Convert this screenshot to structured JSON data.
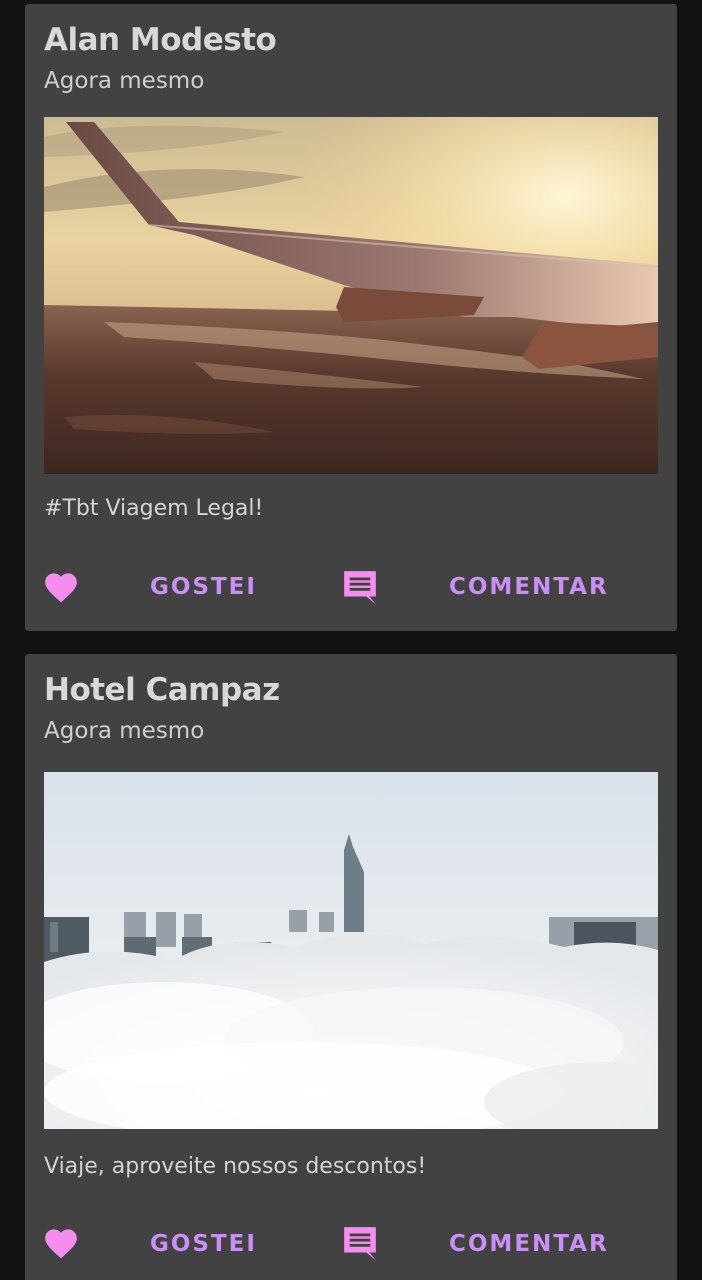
{
  "posts": [
    {
      "author": "Alan Modesto",
      "time": "Agora mesmo",
      "image": "airplane-wing-sunset-photo",
      "caption": "#Tbt Viagem Legal!",
      "like_label": "GOSTEI",
      "comment_label": "COMENTAR"
    },
    {
      "author": "Hotel Campaz",
      "time": "Agora mesmo",
      "image": "city-above-clouds-photo",
      "caption": "Viaje, aproveite nossos descontos!",
      "like_label": "GOSTEI",
      "comment_label": "COMENTAR"
    }
  ],
  "icons": {
    "like": "heart-icon",
    "comment": "comment-icon"
  },
  "colors": {
    "background": "#131313",
    "card": "#424242",
    "accent_text": "#c98ff5",
    "icon_pink": "#f58cf0"
  }
}
